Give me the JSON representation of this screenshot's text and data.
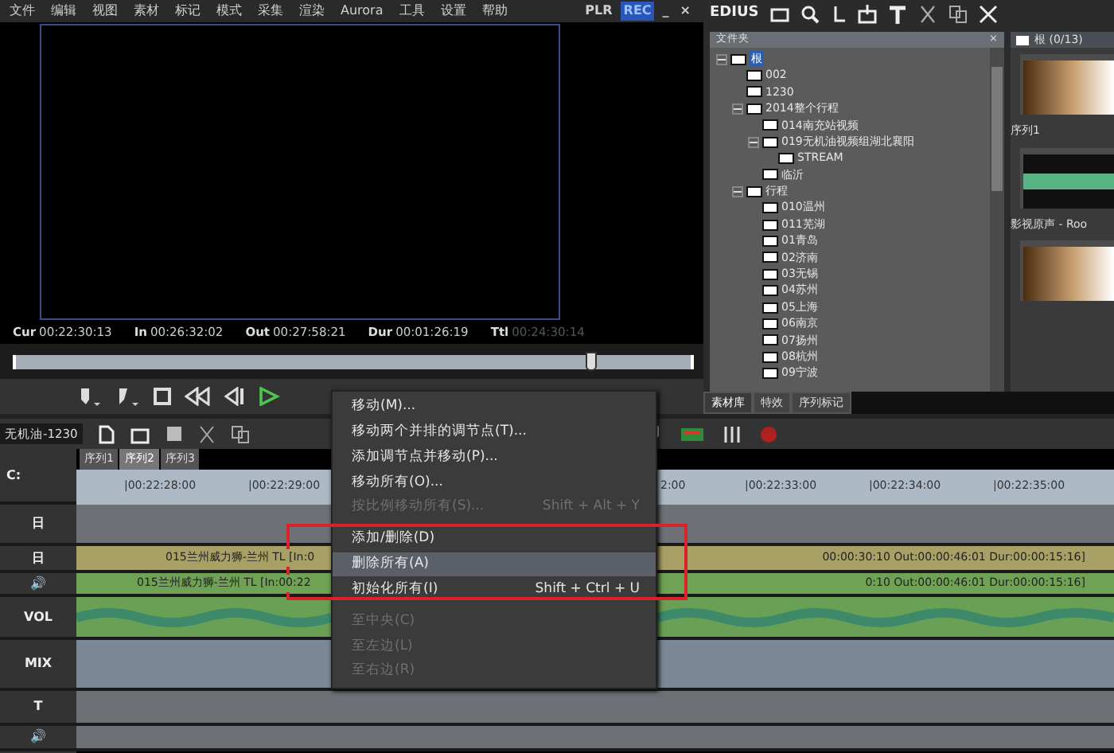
{
  "menu_bar": {
    "items": [
      "文件",
      "编辑",
      "视图",
      "素材",
      "标记",
      "模式",
      "采集",
      "渲染",
      "Aurora",
      "工具",
      "设置",
      "帮助"
    ],
    "modes": [
      {
        "label": "PLR",
        "selected": false
      },
      {
        "label": "REC",
        "selected": true
      }
    ],
    "window_buttons": [
      "_",
      "×"
    ]
  },
  "player": {
    "timecodes": [
      {
        "label": "Cur",
        "value": "00:22:30:13",
        "dim": false
      },
      {
        "label": "In",
        "value": "00:26:32:02",
        "dim": false
      },
      {
        "label": "Out",
        "value": "00:27:58:21",
        "dim": false
      },
      {
        "label": "Dur",
        "value": "00:01:26:19",
        "dim": false
      },
      {
        "label": "Ttl",
        "value": "00:24:30:14",
        "dim": true
      }
    ],
    "scrub": {
      "level": 0.85
    }
  },
  "bin": {
    "app_title": "EDIUS",
    "tree_title": "文件夹",
    "close": "×",
    "tree": [
      {
        "label": "根",
        "expanded": true,
        "selected": true,
        "children": [
          {
            "label": "002"
          },
          {
            "label": "1230"
          },
          {
            "label": "2014整个行程",
            "expanded": true,
            "children": [
              {
                "label": "014南充站视频"
              },
              {
                "label": "019无机油视频组湖北襄阳",
                "expanded": true,
                "children": [
                  {
                    "label": "STREAM"
                  }
                ]
              },
              {
                "label": "临沂"
              }
            ]
          },
          {
            "label": "行程",
            "expanded": true,
            "children": [
              {
                "label": "010温州"
              },
              {
                "label": "011芜湖"
              },
              {
                "label": "01青岛"
              },
              {
                "label": "02济南"
              },
              {
                "label": "03无锡"
              },
              {
                "label": "04苏州"
              },
              {
                "label": "05上海"
              },
              {
                "label": "06南京"
              },
              {
                "label": "07扬州"
              },
              {
                "label": "08杭州"
              },
              {
                "label": "09宁波"
              }
            ]
          }
        ]
      }
    ],
    "clip_header": "根 (0/13)",
    "clips": [
      {
        "name": "序列1",
        "kind": "video"
      },
      {
        "name": "影视原声 - Roo",
        "kind": "audio"
      },
      {
        "kind": "video"
      }
    ],
    "tabs": [
      {
        "label": "素材库",
        "selected": true
      },
      {
        "label": "特效",
        "selected": false
      },
      {
        "label": "序列标记",
        "selected": false
      }
    ]
  },
  "timeline": {
    "sequence_name": "无机油-1230",
    "drive": "C:",
    "tabs": [
      {
        "label": "序列1",
        "selected": false
      },
      {
        "label": "序列2",
        "selected": true
      },
      {
        "label": "序列3",
        "selected": false
      }
    ],
    "ruler": [
      "|00:22:28:00",
      "|00:22:29:00",
      "2:00",
      "|00:22:33:00",
      "|00:22:34:00",
      "|00:22:35:00"
    ],
    "tracks": [
      {
        "kind": "video",
        "label": "日"
      },
      {
        "kind": "clip",
        "label": "日",
        "left": "015兰州威力狮-兰州   TL [In:0",
        "right": "00:00:30:10 Out:00:00:46:01 Dur:00:00:15:16]"
      },
      {
        "kind": "audio",
        "label": "🔊",
        "left": "015兰州威力狮-兰州   TL [In:00:22",
        "right": "0:10 Out:00:00:46:01 Dur:00:00:15:16]"
      },
      {
        "kind": "vol",
        "label": "VOL"
      },
      {
        "kind": "mix",
        "label": "MIX"
      },
      {
        "kind": "title",
        "label": "T"
      },
      {
        "kind": "audio2",
        "label": "🔊"
      }
    ]
  },
  "context_menu": {
    "items": [
      {
        "kind": "item",
        "label": "移动(M)...",
        "disabled": false,
        "selected": false
      },
      {
        "kind": "item",
        "label": "移动两个并排的调节点(T)...",
        "disabled": false,
        "selected": false
      },
      {
        "kind": "item",
        "label": "添加调节点并移动(P)...",
        "disabled": false,
        "selected": false
      },
      {
        "kind": "item",
        "label": "移动所有(O)...",
        "disabled": false,
        "selected": false
      },
      {
        "kind": "item",
        "label": "按比例移动所有(S)...",
        "shortcut": "Shift + Alt + Y",
        "disabled": true,
        "selected": false
      },
      {
        "kind": "separator"
      },
      {
        "kind": "item",
        "label": "添加/删除(D)",
        "disabled": false,
        "selected": false
      },
      {
        "kind": "item",
        "label": "删除所有(A)",
        "disabled": false,
        "selected": true
      },
      {
        "kind": "item",
        "label": "初始化所有(I)",
        "shortcut": "Shift + Ctrl + U",
        "disabled": false,
        "selected": false
      },
      {
        "kind": "separator"
      },
      {
        "kind": "item",
        "label": "至中央(C)",
        "disabled": true,
        "selected": false
      },
      {
        "kind": "item",
        "label": "至左边(L)",
        "disabled": true,
        "selected": false
      },
      {
        "kind": "item",
        "label": "至右边(R)",
        "disabled": true,
        "selected": false
      }
    ],
    "highlight_frame": {
      "color": "#d8232a"
    }
  }
}
